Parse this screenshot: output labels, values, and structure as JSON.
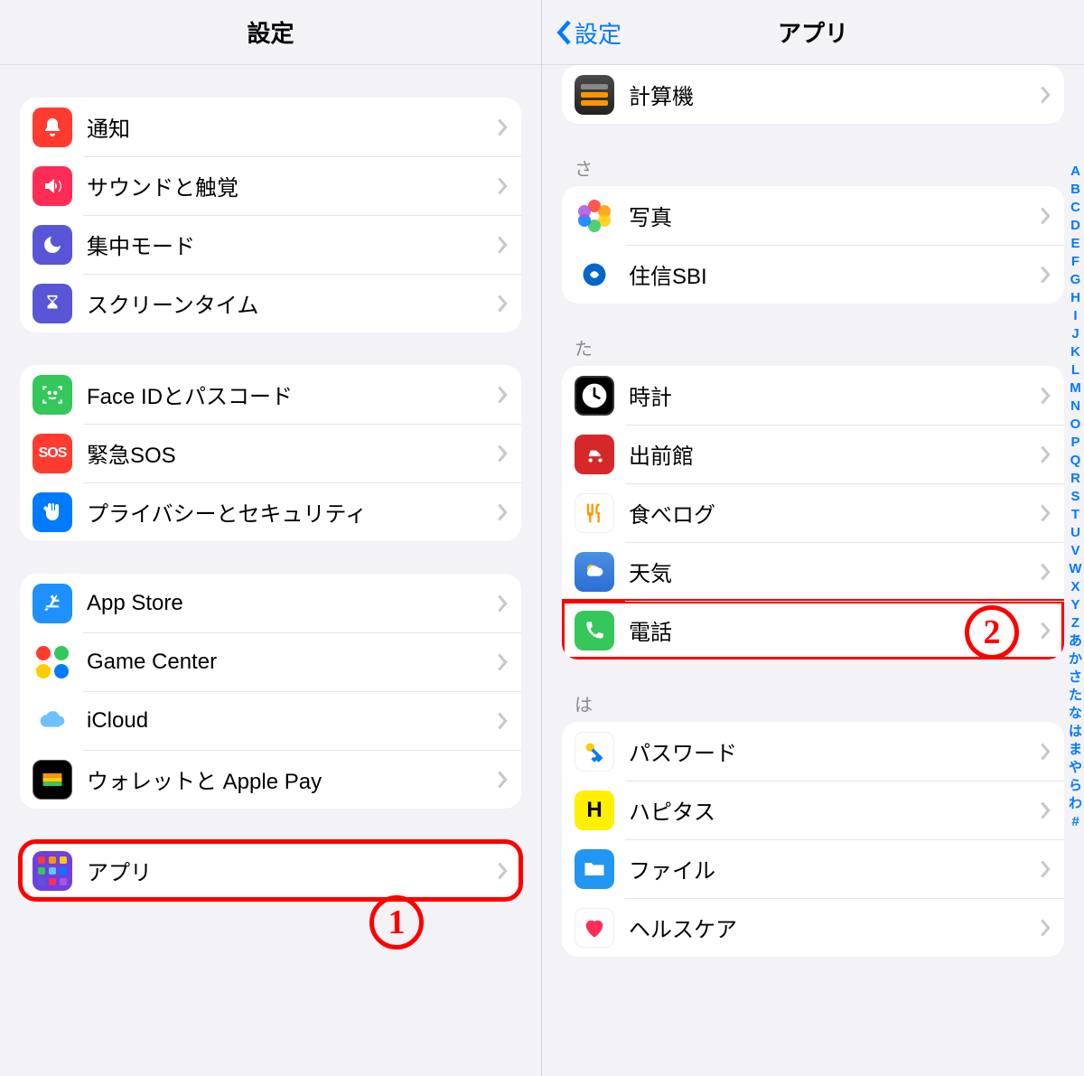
{
  "left": {
    "title": "設定",
    "groups": [
      {
        "rows": [
          {
            "id": "notifications",
            "label": "通知",
            "icon": "bell-icon"
          },
          {
            "id": "sound",
            "label": "サウンドと触覚",
            "icon": "speaker-icon"
          },
          {
            "id": "focus",
            "label": "集中モード",
            "icon": "moon-icon"
          },
          {
            "id": "screentime",
            "label": "スクリーンタイム",
            "icon": "hourglass-icon"
          }
        ]
      },
      {
        "rows": [
          {
            "id": "faceid",
            "label": "Face IDとパスコード",
            "icon": "faceid-icon"
          },
          {
            "id": "sos",
            "label": "緊急SOS",
            "icon": "sos-icon"
          },
          {
            "id": "privacy",
            "label": "プライバシーとセキュリティ",
            "icon": "hand-icon"
          }
        ]
      },
      {
        "rows": [
          {
            "id": "appstore",
            "label": "App Store",
            "icon": "appstore-icon"
          },
          {
            "id": "gamecenter",
            "label": "Game Center",
            "icon": "gamecenter-icon"
          },
          {
            "id": "icloud",
            "label": "iCloud",
            "icon": "cloud-icon"
          },
          {
            "id": "wallet",
            "label": "ウォレットと Apple Pay",
            "icon": "wallet-icon"
          }
        ]
      },
      {
        "rows": [
          {
            "id": "apps",
            "label": "アプリ",
            "icon": "apps-grid-icon",
            "highlight": true
          }
        ]
      }
    ],
    "callout": "1"
  },
  "right": {
    "title": "アプリ",
    "back_label": "設定",
    "top_group": {
      "rows": [
        {
          "id": "calculator",
          "label": "計算機",
          "icon": "calculator-icon"
        }
      ]
    },
    "sections": [
      {
        "header": "さ",
        "rows": [
          {
            "id": "photos",
            "label": "写真",
            "icon": "photos-icon"
          },
          {
            "id": "sbi",
            "label": "住信SBI",
            "icon": "sbi-icon"
          }
        ]
      },
      {
        "header": "た",
        "rows": [
          {
            "id": "clock",
            "label": "時計",
            "icon": "clock-icon"
          },
          {
            "id": "demaekan",
            "label": "出前館",
            "icon": "demae-icon"
          },
          {
            "id": "tabelog",
            "label": "食べログ",
            "icon": "tabelog-icon"
          },
          {
            "id": "weather",
            "label": "天気",
            "icon": "weather-icon"
          },
          {
            "id": "phone",
            "label": "電話",
            "icon": "phone-icon",
            "highlight": true
          }
        ]
      },
      {
        "header": "は",
        "rows": [
          {
            "id": "passwords",
            "label": "パスワード",
            "icon": "key-icon"
          },
          {
            "id": "hapitas",
            "label": "ハピタス",
            "icon": "hapitas-icon"
          },
          {
            "id": "files",
            "label": "ファイル",
            "icon": "folder-icon"
          },
          {
            "id": "health",
            "label": "ヘルスケア",
            "icon": "heart-icon"
          }
        ]
      }
    ],
    "index": [
      "A",
      "B",
      "C",
      "D",
      "E",
      "F",
      "G",
      "H",
      "I",
      "J",
      "K",
      "L",
      "M",
      "N",
      "O",
      "P",
      "Q",
      "R",
      "S",
      "T",
      "U",
      "V",
      "W",
      "X",
      "Y",
      "Z",
      "あ",
      "か",
      "さ",
      "た",
      "な",
      "は",
      "ま",
      "や",
      "ら",
      "わ",
      "#"
    ],
    "callout": "2"
  }
}
